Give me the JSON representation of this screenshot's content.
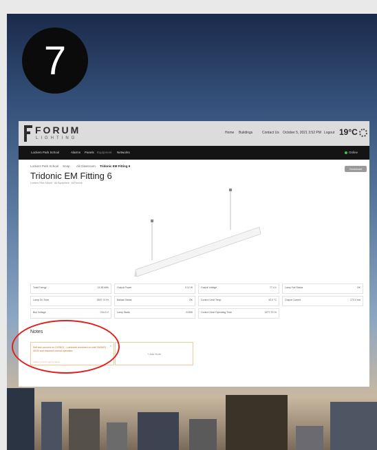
{
  "step_badge": "7",
  "header": {
    "logo_text": "FORUM",
    "logo_sub": "LIGHTING",
    "links": [
      "Home",
      "Buildings",
      "Contact Us",
      "October 5, 2021 3:52 PM",
      "Logout"
    ],
    "temperature": "19°C"
  },
  "nav": {
    "items": [
      "Lockers Park School",
      "Alarms",
      "Panels",
      "Equipment",
      "Networks"
    ],
    "status": "Online"
  },
  "breadcrumb": [
    "Lockers Park School",
    "Snap",
    "All Classroom",
    "Tridonic EM Fitting 6"
  ],
  "download_label": "Download",
  "title": "Tridonic EM Fitting 6",
  "subtitle": "Lockers Park School · All Equipment · All Rooms",
  "metrics": [
    {
      "label": "Total Energy",
      "value": "13.38 kWh"
    },
    {
      "label": "Output Power",
      "value": "0.12 W"
    },
    {
      "label": "Output Voltage",
      "value": "77.4 V"
    },
    {
      "label": "Lamp Fail Status",
      "value": "OK"
    },
    {
      "label": "Lamp On Time",
      "value": "3507.70 Hr"
    },
    {
      "label": "Ballast Status",
      "value": "OK"
    },
    {
      "label": "Control Gear Temp",
      "value": "42.0 °C"
    },
    {
      "label": "Output Current",
      "value": "273.0 mA"
    },
    {
      "label": "Bus Voltage",
      "value": "224.0 V"
    },
    {
      "label": "Lamp Starts",
      "value": "22305"
    },
    {
      "label": "Control Gear Operating Time",
      "value": "3277.70 Hr"
    }
  ],
  "notes": {
    "heading": "Notes",
    "note_text": "Self test occured on 10/05/21 - Luminaire remained on until 30/05/21 08:00 and resumed normal operation.",
    "note_meta": "Added 1 month ago by admin",
    "close_glyph": "×",
    "add_label": "+ Add Note"
  },
  "colors": {
    "highlight_ring": "#e0201e",
    "note_accent": "#c07020",
    "status_online": "#3cc24a"
  }
}
